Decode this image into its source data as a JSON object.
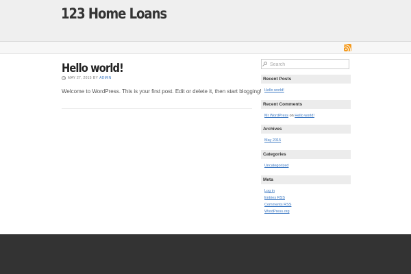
{
  "site": {
    "title": "123 Home Loans"
  },
  "post": {
    "title": "Hello world!",
    "date": "MAY 27, 2015",
    "by": "BY",
    "author": "ADMIN",
    "content": "Welcome to WordPress. This is your first post. Edit or delete it, then start blogging!"
  },
  "sidebar": {
    "search": {
      "placeholder": "Search"
    },
    "recent_posts": {
      "title": "Recent Posts",
      "items": [
        "Hello world!"
      ]
    },
    "recent_comments": {
      "title": "Recent Comments",
      "author": "Mr WordPress",
      "on": "on",
      "post": "Hello world!"
    },
    "archives": {
      "title": "Archives",
      "items": [
        "May 2015"
      ]
    },
    "categories": {
      "title": "Categories",
      "items": [
        "Uncategorized"
      ]
    },
    "meta": {
      "title": "Meta",
      "items": [
        "Log in",
        "Entries RSS",
        "Comments RSS",
        "WordPress.org"
      ]
    }
  },
  "colors": {
    "header_bg": "#efefef",
    "link": "#3a77c2",
    "rss": "#f39a1e",
    "footer_bg": "#333333"
  },
  "icons": {
    "rss": "rss-icon",
    "clock": "clock-icon",
    "search": "search-icon"
  }
}
